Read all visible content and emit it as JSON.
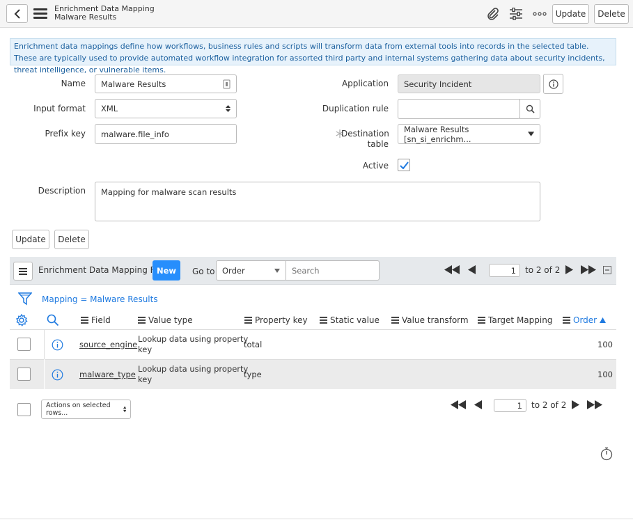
{
  "header": {
    "table_label": "Enrichment Data Mapping",
    "record_label": "Malware Results",
    "update_label": "Update",
    "delete_label": "Delete"
  },
  "info_message": "Enrichment data mappings define how workflows, business rules and scripts will transform data from external tools into records in the selected table. These are typically used to provide automated workflow integration for assorted third party and internal systems gathering data about security incidents, threat intelligence, or vulnerable items.",
  "form": {
    "name_label": "Name",
    "name_value": "Malware Results",
    "input_format_label": "Input format",
    "input_format_value": "XML",
    "prefix_key_label": "Prefix key",
    "prefix_key_value": "malware.file_info",
    "application_label": "Application",
    "application_value": "Security Incident",
    "duplication_rule_label": "Duplication rule",
    "duplication_rule_value": "",
    "destination_table_label_1": "Destination",
    "destination_table_label_2": "table",
    "destination_table_value": "Malware Results [sn_si_enrichm...",
    "active_label": "Active",
    "active_checked": true,
    "description_label": "Description",
    "description_value": "Mapping for malware scan results",
    "update_label": "Update",
    "delete_label": "Delete"
  },
  "related_list": {
    "title": "Enrichment Data Mapping Fields",
    "new_label": "New",
    "goto_label": "Go to",
    "goto_field": "Order",
    "search_placeholder": "Search",
    "page_input": "1",
    "page_range": "to 2 of 2",
    "filter_text": "Mapping = Malware Results",
    "columns": [
      "Field",
      "Value type",
      "Property key",
      "Static value",
      "Value transform",
      "Target Mapping",
      "Order"
    ],
    "rows": [
      {
        "field": "source_engine",
        "value_type_1": "Lookup data using property",
        "value_type_2": "key",
        "property_key": "total",
        "static_value": "",
        "value_transform": "",
        "target_mapping": "",
        "order": "100"
      },
      {
        "field": "malware_type",
        "value_type_1": "Lookup data using property",
        "value_type_2": "key",
        "property_key": "type",
        "static_value": "",
        "value_transform": "",
        "target_mapping": "",
        "order": "100"
      }
    ],
    "actions_label": "Actions on selected rows...",
    "bottom_page_input": "1",
    "bottom_page_range": "to 2 of 2"
  },
  "colors": {
    "accent": "#278efc",
    "info_bg": "#e7f2fb",
    "info_text": "#1a5f9e",
    "sort_blue": "#1f7ae0"
  }
}
